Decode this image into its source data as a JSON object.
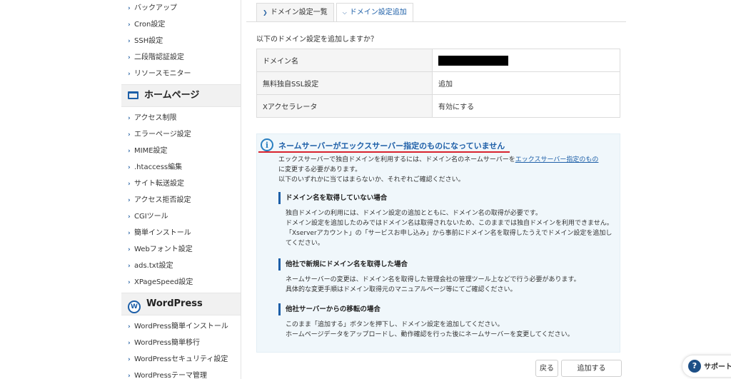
{
  "sidebar": {
    "items_top": [
      "バックアップ",
      "Cron設定",
      "SSH設定",
      "二段階認証設定",
      "リソースモニター"
    ],
    "section_homepage": "ホームページ",
    "items_homepage": [
      "アクセス制限",
      "エラーページ設定",
      "MIME設定",
      ".htaccess編集",
      "サイト転送設定",
      "アクセス拒否設定",
      "CGIツール",
      "簡単インストール",
      "Webフォント設定",
      "ads.txt設定",
      "XPageSpeed設定"
    ],
    "section_wordpress": "WordPress",
    "items_wordpress": [
      "WordPress簡単インストール",
      "WordPress簡単移行",
      "WordPressセキュリティ設定",
      "WordPressテーマ管理"
    ]
  },
  "tabs": {
    "list": "ドメイン設定一覧",
    "add": "ドメイン設定追加"
  },
  "intro": "以下のドメイン設定を追加しますか？",
  "table": {
    "rows": [
      {
        "key": "ドメイン名",
        "value": ""
      },
      {
        "key": "無料独自SSL設定",
        "value": "追加"
      },
      {
        "key": "Xアクセラレータ",
        "value": "有効にする"
      }
    ]
  },
  "notice": {
    "title": "ネームサーバーがエックスサーバー指定のものになっていません",
    "body1_pre": "エックスサーバーで独自ドメインを利用するには、ドメイン名のネームサーバーを",
    "body1_link": "エックスサーバー指定のもの",
    "body1_post": "に変更する必要があります。",
    "body2": "以下のいずれかに当てはまらないか、それぞれご確認ください。",
    "sections": [
      {
        "heading": "ドメイン名を取得していない場合",
        "lines": [
          "独自ドメインの利用には、ドメイン設定の追加とともに、ドメイン名の取得が必要です。",
          "ドメイン設定を追加したのみではドメイン名は取得されないため、このままでは独自ドメインを利用できません。",
          "「Xserverアカウント」の「サービスお申し込み」から事前にドメイン名を取得したうえでドメイン設定を追加してください。"
        ]
      },
      {
        "heading": "他社で新規にドメイン名を取得した場合",
        "lines": [
          "ネームサーバーの変更は、ドメイン名を取得した管理会社の管理ツール上などで行う必要があります。",
          "具体的な変更手順はドメイン取得元のマニュアルページ等にてご確認ください。"
        ]
      },
      {
        "heading": "他社サーバーからの移転の場合",
        "lines": [
          "このまま「追加する」ボタンを押下し、ドメイン設定を追加してください。",
          "ホームページデータをアップロードし、動作確認を行った後にネームサーバーを変更してください。"
        ]
      }
    ]
  },
  "buttons": {
    "back": "戻る",
    "submit": "追加する"
  },
  "support": "サポート"
}
